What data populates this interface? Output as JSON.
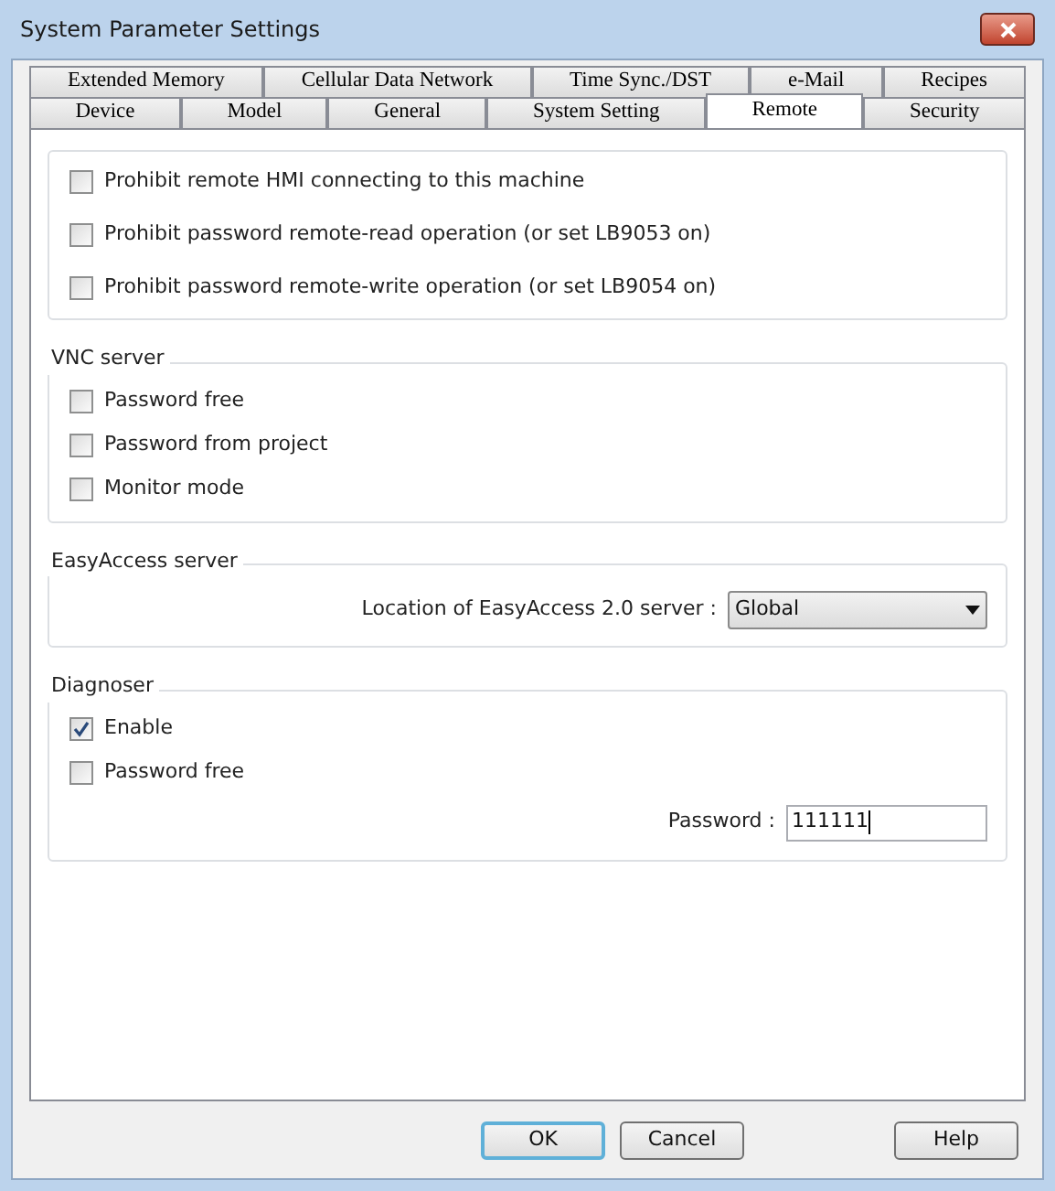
{
  "window": {
    "title": "System Parameter Settings"
  },
  "tab_rows": [
    [
      {
        "label": "Extended Memory",
        "selected": false
      },
      {
        "label": "Cellular Data Network",
        "selected": false
      },
      {
        "label": "Time Sync./DST",
        "selected": false
      },
      {
        "label": "e-Mail",
        "selected": false
      },
      {
        "label": "Recipes",
        "selected": false
      }
    ],
    [
      {
        "label": "Device",
        "selected": false
      },
      {
        "label": "Model",
        "selected": false
      },
      {
        "label": "General",
        "selected": false
      },
      {
        "label": "System Setting",
        "selected": false
      },
      {
        "label": "Remote",
        "selected": true
      },
      {
        "label": "Security",
        "selected": false
      }
    ]
  ],
  "sections": [
    {
      "items": [
        {
          "kind": "checkbox",
          "label": "Prohibit remote HMI connecting to this machine",
          "checked": false
        },
        {
          "kind": "checkbox",
          "label": "Prohibit password remote-read operation (or set LB9053 on)",
          "checked": false
        },
        {
          "kind": "checkbox",
          "label": "Prohibit password remote-write operation (or set LB9054 on)",
          "checked": false
        }
      ]
    },
    {
      "title": "VNC server",
      "items": [
        {
          "kind": "checkbox",
          "label": "Password free",
          "checked": false
        },
        {
          "kind": "checkbox",
          "label": "Password from project",
          "checked": false
        },
        {
          "kind": "checkbox",
          "label": "Monitor mode",
          "checked": false
        }
      ]
    },
    {
      "title": "EasyAccess server",
      "items": [
        {
          "kind": "dropdown",
          "label": "Location of EasyAccess 2.0 server :",
          "value": "Global"
        }
      ]
    },
    {
      "title": "Diagnoser",
      "items": [
        {
          "kind": "checkbox",
          "label": "Enable",
          "checked": true
        },
        {
          "kind": "checkbox",
          "label": "Password free",
          "checked": false
        },
        {
          "kind": "field",
          "label": "Password :",
          "value": "111111"
        }
      ]
    }
  ],
  "buttons": [
    {
      "label": "OK",
      "default": true
    },
    {
      "label": "Cancel",
      "default": false
    },
    {
      "label": "Help",
      "default": false
    }
  ]
}
